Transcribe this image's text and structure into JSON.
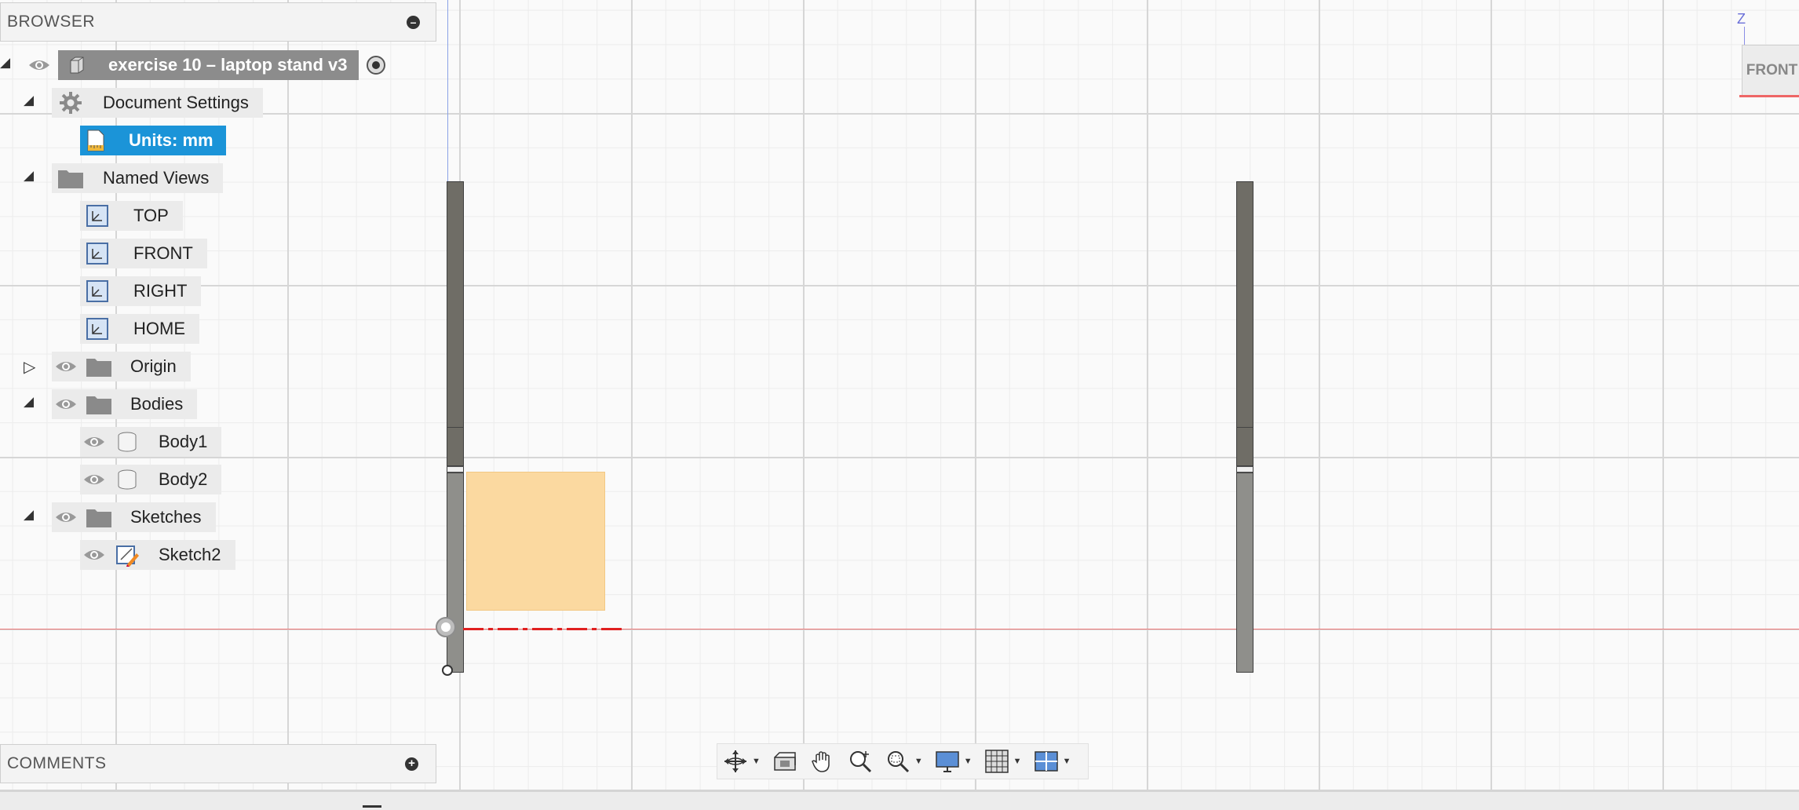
{
  "browser": {
    "title": "BROWSER",
    "root": {
      "label": "exercise 10 – laptop stand v3"
    },
    "document_settings": {
      "label": "Document Settings",
      "units": "Units: mm"
    },
    "named_views": {
      "label": "Named Views",
      "items": [
        "TOP",
        "FRONT",
        "RIGHT",
        "HOME"
      ]
    },
    "origin": {
      "label": "Origin"
    },
    "bodies": {
      "label": "Bodies",
      "items": [
        "Body1",
        "Body2"
      ]
    },
    "sketches": {
      "label": "Sketches",
      "items": [
        "Sketch2"
      ]
    }
  },
  "comments": {
    "title": "COMMENTS"
  },
  "viewcube": {
    "face": "FRONT",
    "axis": "Z"
  },
  "toolbar": {
    "tools": [
      "orbit-icon",
      "look-at-icon",
      "pan-icon",
      "zoom-icon",
      "zoom-window-icon",
      "display-settings-icon",
      "grid-icon",
      "viewports-icon"
    ]
  },
  "colors": {
    "selection": "#1b94d8",
    "sketch_profile": "#fbd9a0",
    "x_axis": "#e02020",
    "z_axis": "#6a6fd8"
  }
}
